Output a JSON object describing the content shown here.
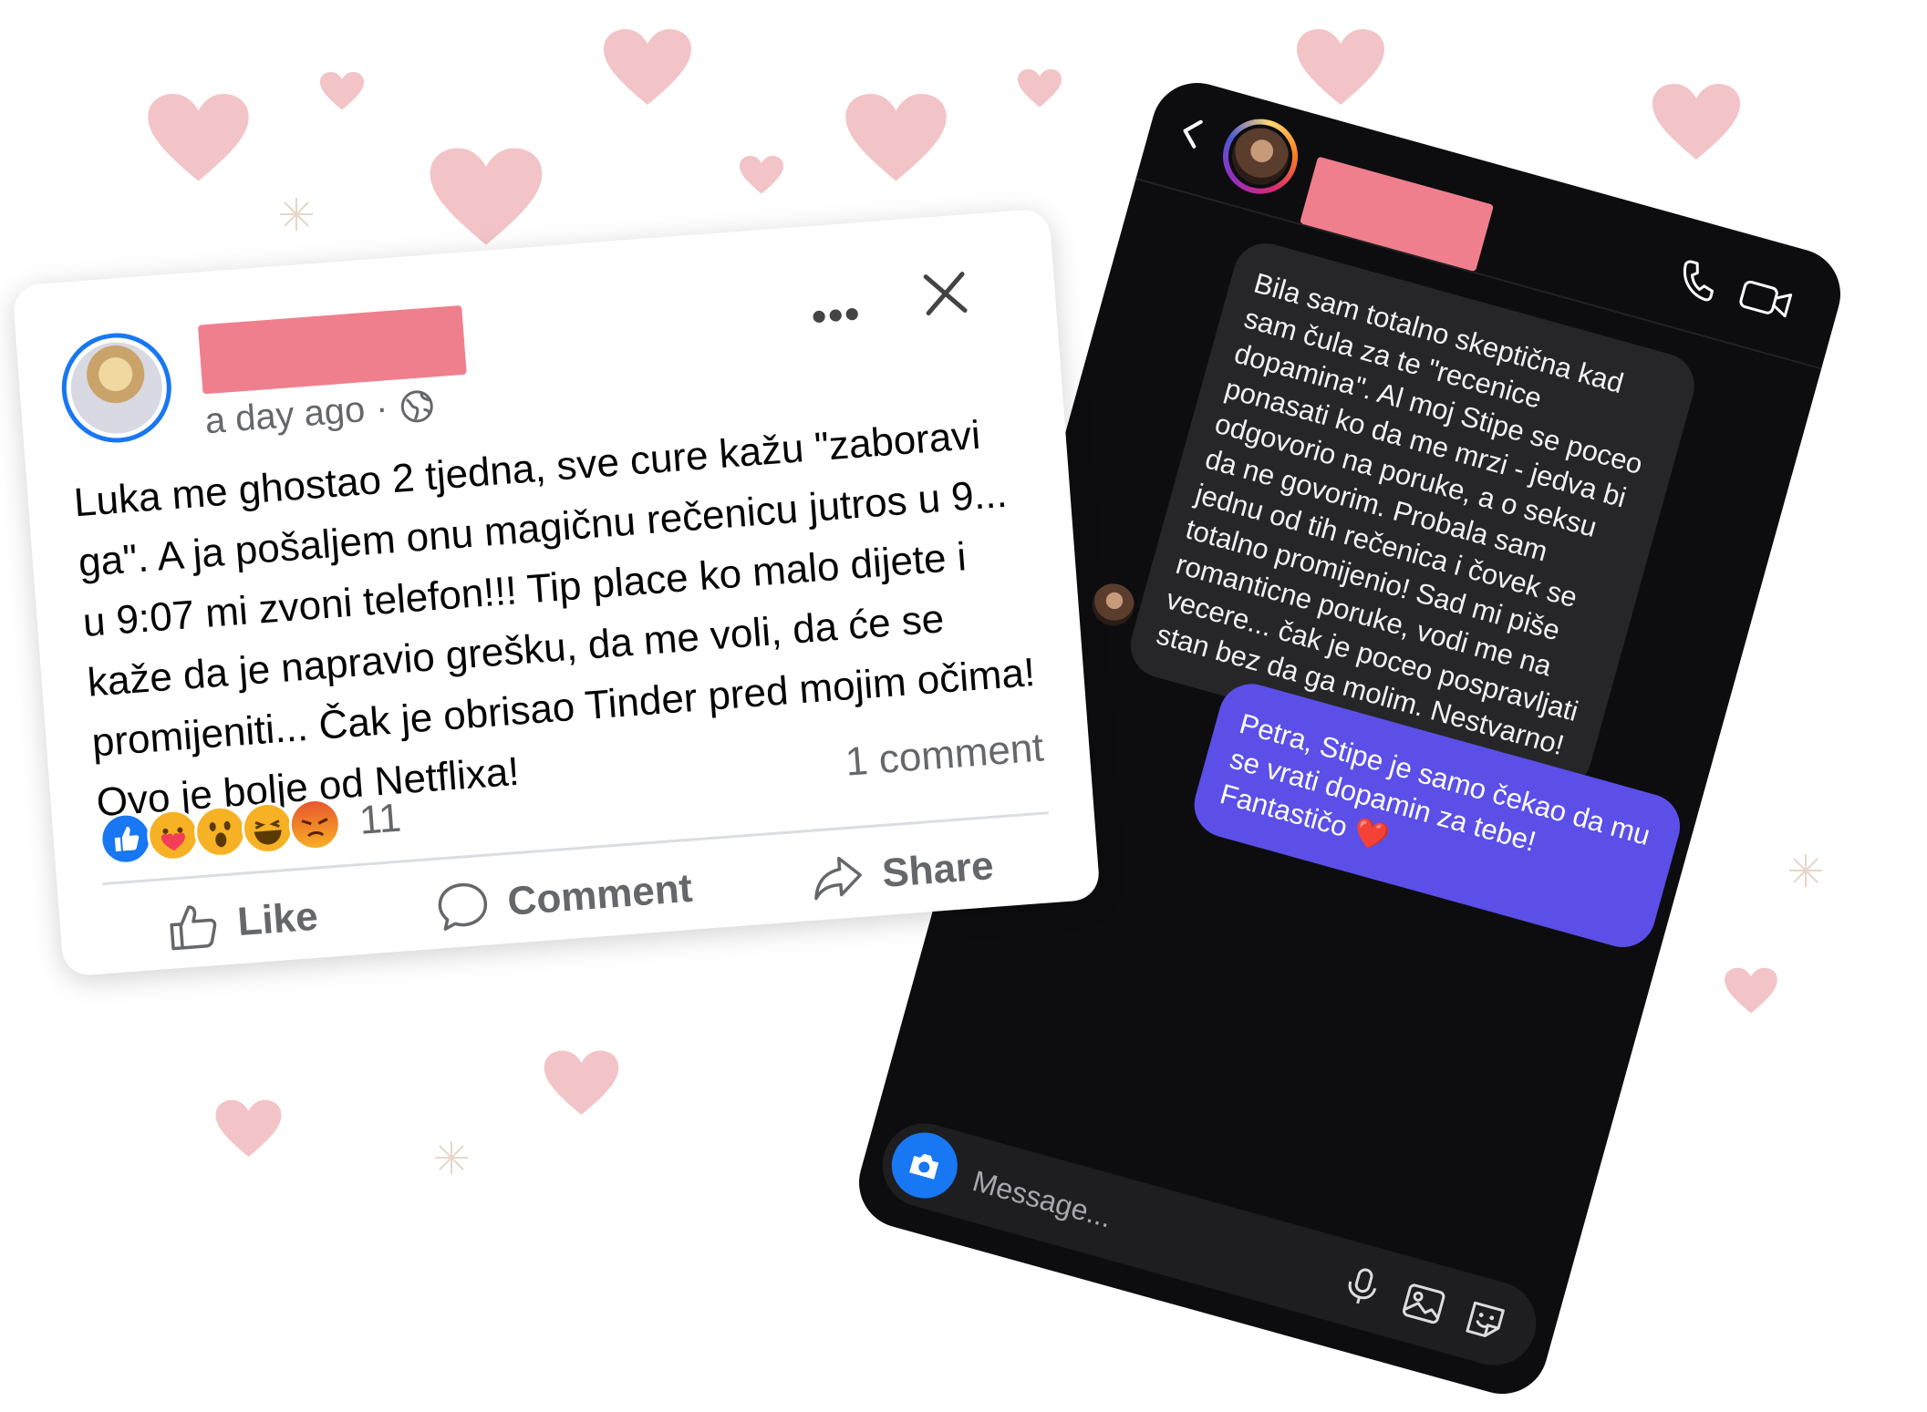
{
  "facebook_post": {
    "time": "a day ago",
    "separator": "·",
    "more_label": "•••",
    "text": "Luka me ghostao 2 tjedna, sve cure kažu \"zaboravi ga\".  A ja pošaljem onu magičnu rečenicu jutros u 9... u 9:07 mi zvoni telefon!!! Tip place ko malo dijete i kaže da je napravio grešku, da me voli, da će se promijeniti... Čak je obrisao Tinder pred mojim očima! Ovo je bolje od Netflixa!",
    "reaction_count": "11",
    "comment_count": "1 comment",
    "actions": {
      "like": "Like",
      "comment": "Comment",
      "share": "Share"
    },
    "reactions": [
      "like-icon",
      "care-icon",
      "wow-icon",
      "haha-icon",
      "angry-icon"
    ]
  },
  "instagram_dm": {
    "incoming_message": "Bila sam totalno skeptična kad sam čula za te \"recenice dopamina\". Al moj Stipe se poceo ponasati ko da me mrzi - jedva bi odgovorio na poruke, a o seksu da ne govorim. Probala sam jednu od tih rečenica i čovek se totalno promijenio! Sad mi piše romanticne poruke, vodi me na vecere... čak je poceo pospravljati stan bez da ga molim. Nestvarno!",
    "outgoing_message": "Petra, Stipe je samo čekao da mu se vrati dopamin za tebe! Fantastičo ❤️",
    "composer_placeholder": "Message..."
  },
  "colors": {
    "redaction": "#f07f8e",
    "facebook_blue": "#1877f2",
    "dm_background": "#0d0d10",
    "incoming_bubble": "#262629",
    "outgoing_bubble": "#5b4fe8",
    "heart": "#f2c4c7"
  }
}
